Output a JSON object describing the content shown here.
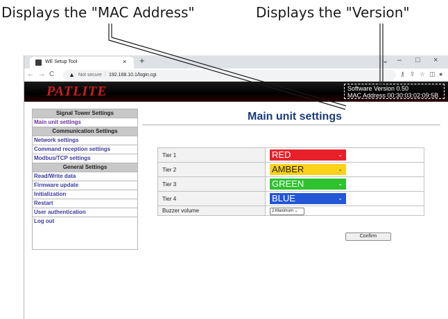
{
  "callouts": {
    "mac": "Displays the \"MAC Address\"",
    "version": "Displays the \"Version\""
  },
  "browser": {
    "tab_title": "WE Setup Tool",
    "tab_close": "×",
    "new_tab": "+",
    "minimize": "–",
    "maximize": "□",
    "close": "×",
    "chevron": "⌄",
    "security_label": "Not secure",
    "url": "192.168.10.1/login.cgi"
  },
  "header": {
    "logo": "PATLITE",
    "software_version": "Software Version  0.50",
    "mac_address": "MAC Address  00:30:03:02:09:5B"
  },
  "sidebar": {
    "items": [
      {
        "label": "Signal Tower Settings",
        "type": "heading"
      },
      {
        "label": "Main unit settings",
        "type": "link",
        "active": true
      },
      {
        "label": "Communication Settings",
        "type": "heading"
      },
      {
        "label": "Network settings",
        "type": "link"
      },
      {
        "label": "Command reception settings",
        "type": "link"
      },
      {
        "label": "Modbus/TCP settings",
        "type": "link"
      },
      {
        "label": "General Settings",
        "type": "heading"
      },
      {
        "label": "Read/Write data",
        "type": "link"
      },
      {
        "label": "Firmware update",
        "type": "link"
      },
      {
        "label": "Initialization",
        "type": "link"
      },
      {
        "label": "Restart",
        "type": "link"
      },
      {
        "label": "User authentication",
        "type": "link"
      },
      {
        "label": "Log out",
        "type": "link"
      }
    ]
  },
  "main": {
    "title": "Main unit settings",
    "rows": [
      {
        "label": "Tier 1",
        "value": "RED",
        "color": "#e8202a"
      },
      {
        "label": "Tier 2",
        "value": "AMBER",
        "color": "#ffd21a"
      },
      {
        "label": "Tier 3",
        "value": "GREEN",
        "color": "#2ec22e"
      },
      {
        "label": "Tier 4",
        "value": "BLUE",
        "color": "#2457d6"
      },
      {
        "label": "Buzzer volume",
        "value": "2:Maximum"
      }
    ],
    "confirm_label": "Confirm"
  },
  "icons": {
    "dropdown": "⌄"
  }
}
